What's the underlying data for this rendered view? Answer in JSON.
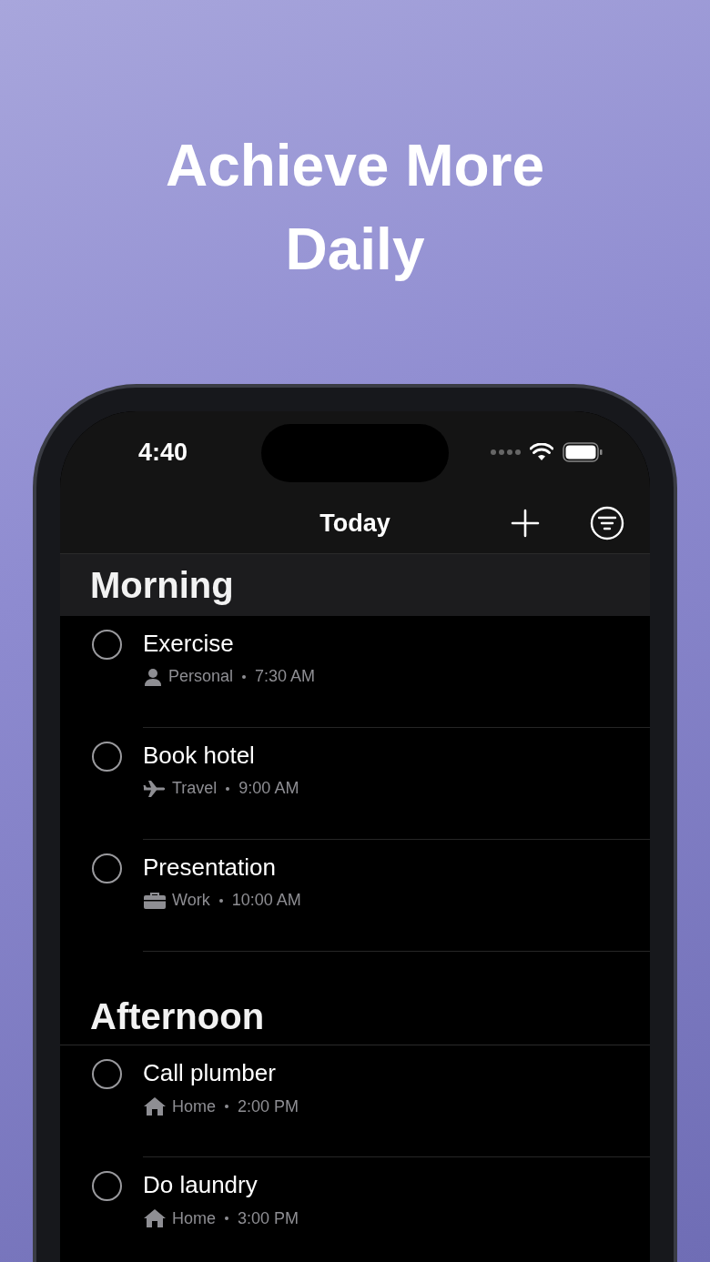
{
  "headline": "Achieve More Daily",
  "status_bar": {
    "time": "4:40"
  },
  "nav_bar": {
    "title": "Today"
  },
  "sections": [
    {
      "title": "Morning",
      "pinned": true,
      "tasks": [
        {
          "title": "Exercise",
          "checked": false,
          "kind": "person",
          "category": "Personal",
          "time": "7:30 AM"
        },
        {
          "title": "Book hotel",
          "checked": false,
          "kind": "plane",
          "category": "Travel",
          "time": "9:00 AM"
        },
        {
          "title": "Presentation",
          "checked": false,
          "kind": "briefcase",
          "category": "Work",
          "time": "10:00 AM"
        }
      ]
    },
    {
      "title": "Afternoon",
      "pinned": false,
      "tasks": [
        {
          "title": "Call plumber",
          "checked": false,
          "kind": "house",
          "category": "Home",
          "time": "2:00 PM"
        },
        {
          "title": "Do laundry",
          "checked": false,
          "kind": "house",
          "category": "Home",
          "time": "3:00 PM"
        }
      ]
    }
  ]
}
